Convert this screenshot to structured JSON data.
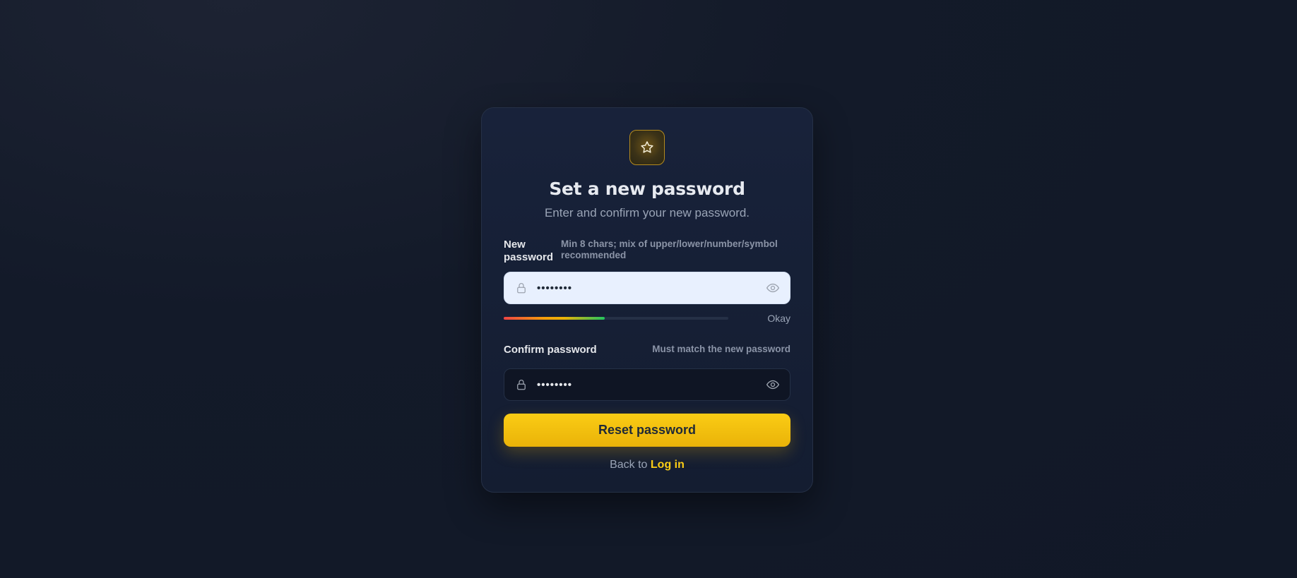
{
  "header": {
    "title": "Set a new password",
    "subtitle": "Enter and confirm your new password."
  },
  "logo": {
    "icon": "star-icon",
    "accent": "#facc15"
  },
  "new_password": {
    "label": "New password",
    "hint": "Min 8 chars; mix of upper/lower/number/symbol recommended",
    "value": "••••••••",
    "strength_label": "Okay",
    "strength_fraction": 0.45
  },
  "confirm_password": {
    "label": "Confirm password",
    "hint": "Must match the new password",
    "value": "••••••••"
  },
  "submit": {
    "label": "Reset password"
  },
  "footer": {
    "prefix": "Back to",
    "link": "Log in"
  },
  "colors": {
    "accent": "#facc15",
    "background": "#111827",
    "card": "#161f34"
  }
}
